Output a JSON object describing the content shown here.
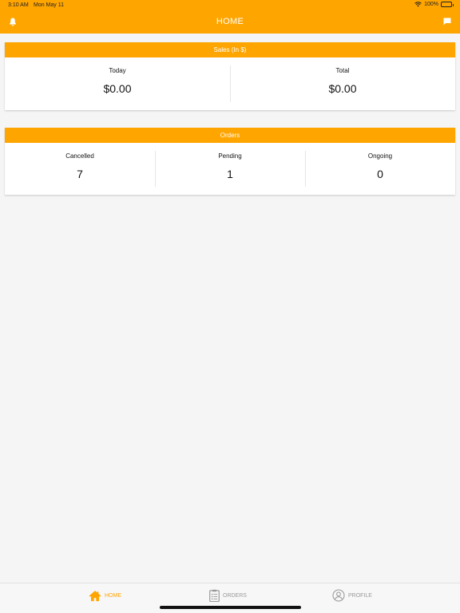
{
  "status_bar": {
    "time": "3:10 AM",
    "date": "Mon May 11",
    "battery": "100%",
    "icons": [
      "wifi-icon",
      "battery-icon"
    ]
  },
  "header": {
    "title": "HOME",
    "left_icon": "bell-icon",
    "right_icon": "chat-icon"
  },
  "sales": {
    "title": "Sales (In $)",
    "items": [
      {
        "label": "Today",
        "value": "$0.00"
      },
      {
        "label": "Total",
        "value": "$0.00"
      }
    ]
  },
  "orders": {
    "title": "Orders",
    "items": [
      {
        "label": "Cancelled",
        "value": "7"
      },
      {
        "label": "Pending",
        "value": "1"
      },
      {
        "label": "Ongoing",
        "value": "0"
      }
    ]
  },
  "tabs": [
    {
      "label": "HOME",
      "icon": "home-icon",
      "active": true
    },
    {
      "label": "ORDERS",
      "icon": "clipboard-icon",
      "active": false
    },
    {
      "label": "PROFILE",
      "icon": "user-circle-icon",
      "active": false
    }
  ],
  "colors": {
    "accent": "#ffa500",
    "background": "#f5f5f5",
    "inactive_tab": "#999999"
  }
}
